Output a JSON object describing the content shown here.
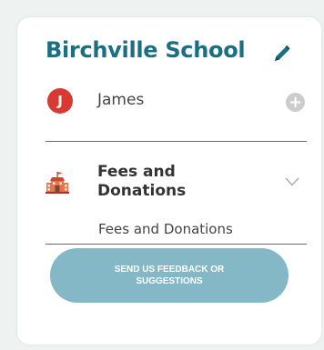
{
  "school": {
    "name": "Birchville School",
    "edit_icon": "pencil-icon"
  },
  "user": {
    "initial": "J",
    "name": "James",
    "add_icon": "plus-icon"
  },
  "section": {
    "title": "Fees and Donations",
    "icon": "school-building-icon",
    "expand_icon": "chevron-down-icon",
    "items": [
      {
        "label": "Fees and Donations"
      }
    ]
  },
  "feedback": {
    "label": "SEND US FEEDBACK OR SUGGESTIONS"
  },
  "colors": {
    "title": "#1a6f83",
    "avatar": "#d83a32",
    "button": "#85b8c7",
    "background": "#eef3f2"
  }
}
